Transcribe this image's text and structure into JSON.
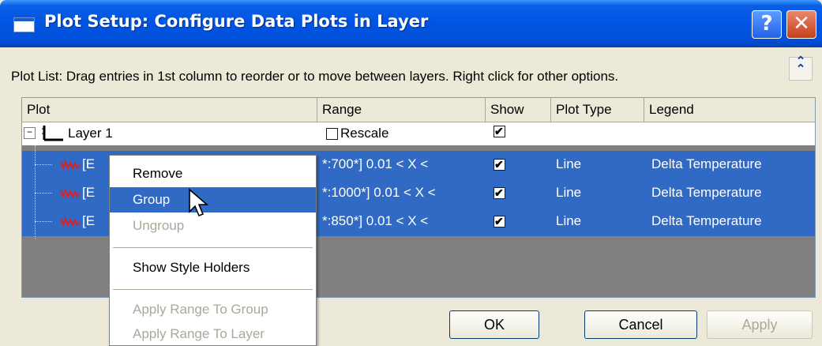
{
  "window": {
    "title": "Plot Setup: Configure Data Plots in Layer",
    "help_label": "?",
    "close_label": "✕"
  },
  "info_text": "Plot List: Drag entries in 1st column to reorder or to move between layers. Right click for other options.",
  "collapse_label": "⌃",
  "columns": [
    "Plot",
    "Range",
    "Show",
    "Plot Type",
    "Legend"
  ],
  "layer": {
    "expander": "⊟",
    "label": "Layer 1",
    "range_label": "Rescale",
    "show_checked": true
  },
  "plots": [
    {
      "plot": "[E",
      "range": "*:700*]  0.01 < X <",
      "show": "✔",
      "type": "Line",
      "legend": "Delta Temperature"
    },
    {
      "plot": "[E",
      "range": "*:1000*]  0.01 < X <",
      "show": "✔",
      "type": "Line",
      "legend": "Delta Temperature"
    },
    {
      "plot": "[E",
      "range": "*:850*]  0.01 < X <",
      "show": "✔",
      "type": "Line",
      "legend": "Delta Temperature"
    }
  ],
  "buttons": {
    "ok": "OK",
    "cancel": "Cancel",
    "apply": "Apply"
  },
  "context_menu": {
    "items": [
      {
        "label": "Remove",
        "state": "enabled"
      },
      {
        "label": "Group",
        "state": "highlighted"
      },
      {
        "label": "Ungroup",
        "state": "disabled"
      },
      {
        "label": "Show Style Holders",
        "state": "enabled"
      },
      {
        "label": "Apply Range To Group",
        "state": "disabled"
      },
      {
        "label": "Apply Range To Layer",
        "state": "disabled"
      }
    ]
  },
  "colors": {
    "titlebar": "#0054e3",
    "selection": "#316ac5",
    "dialog_bg": "#ece9d8",
    "list_empty": "#808080",
    "plot_icon": "#e02020"
  }
}
